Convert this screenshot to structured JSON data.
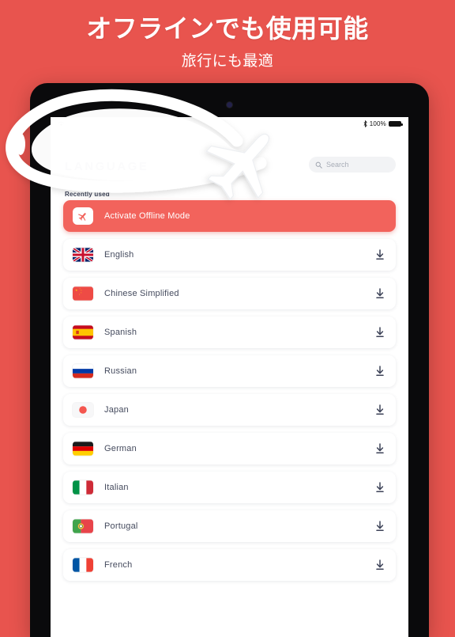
{
  "promo": {
    "title": "オフラインでも使用可能",
    "subtitle": "旅行にも最適"
  },
  "device": {
    "statusbar": {
      "wifi_icon": "wifi-icon",
      "bluetooth_icon": "bluetooth-icon",
      "battery_percent": "100%",
      "battery_icon": "battery-full-icon"
    }
  },
  "app": {
    "title": "LANGUAGE",
    "section_label": "Recently used",
    "search": {
      "placeholder": "Search",
      "value": "",
      "icon": "search-icon"
    },
    "offline_row": {
      "label": "Activate Offline Mode",
      "icon": "airplane-icon"
    },
    "download_icon": "download-icon",
    "languages": [
      {
        "label": "English",
        "flag": "flag-uk"
      },
      {
        "label": "Chinese Simplified",
        "flag": "flag-china"
      },
      {
        "label": "Spanish",
        "flag": "flag-spain"
      },
      {
        "label": "Russian",
        "flag": "flag-russia"
      },
      {
        "label": "Japan",
        "flag": "flag-japan"
      },
      {
        "label": "German",
        "flag": "flag-germany"
      },
      {
        "label": "Italian",
        "flag": "flag-italy"
      },
      {
        "label": "Portugal",
        "flag": "flag-portugal"
      },
      {
        "label": "French",
        "flag": "flag-france"
      }
    ]
  },
  "decor": {
    "airplane_illustration": "airplane-illustration",
    "swoosh_illustration": "swoosh-illustration"
  },
  "colors": {
    "background_red": "#e8544e",
    "offline_red": "#f2635c",
    "text_navy": "#454b5e",
    "card_white": "#ffffff"
  }
}
